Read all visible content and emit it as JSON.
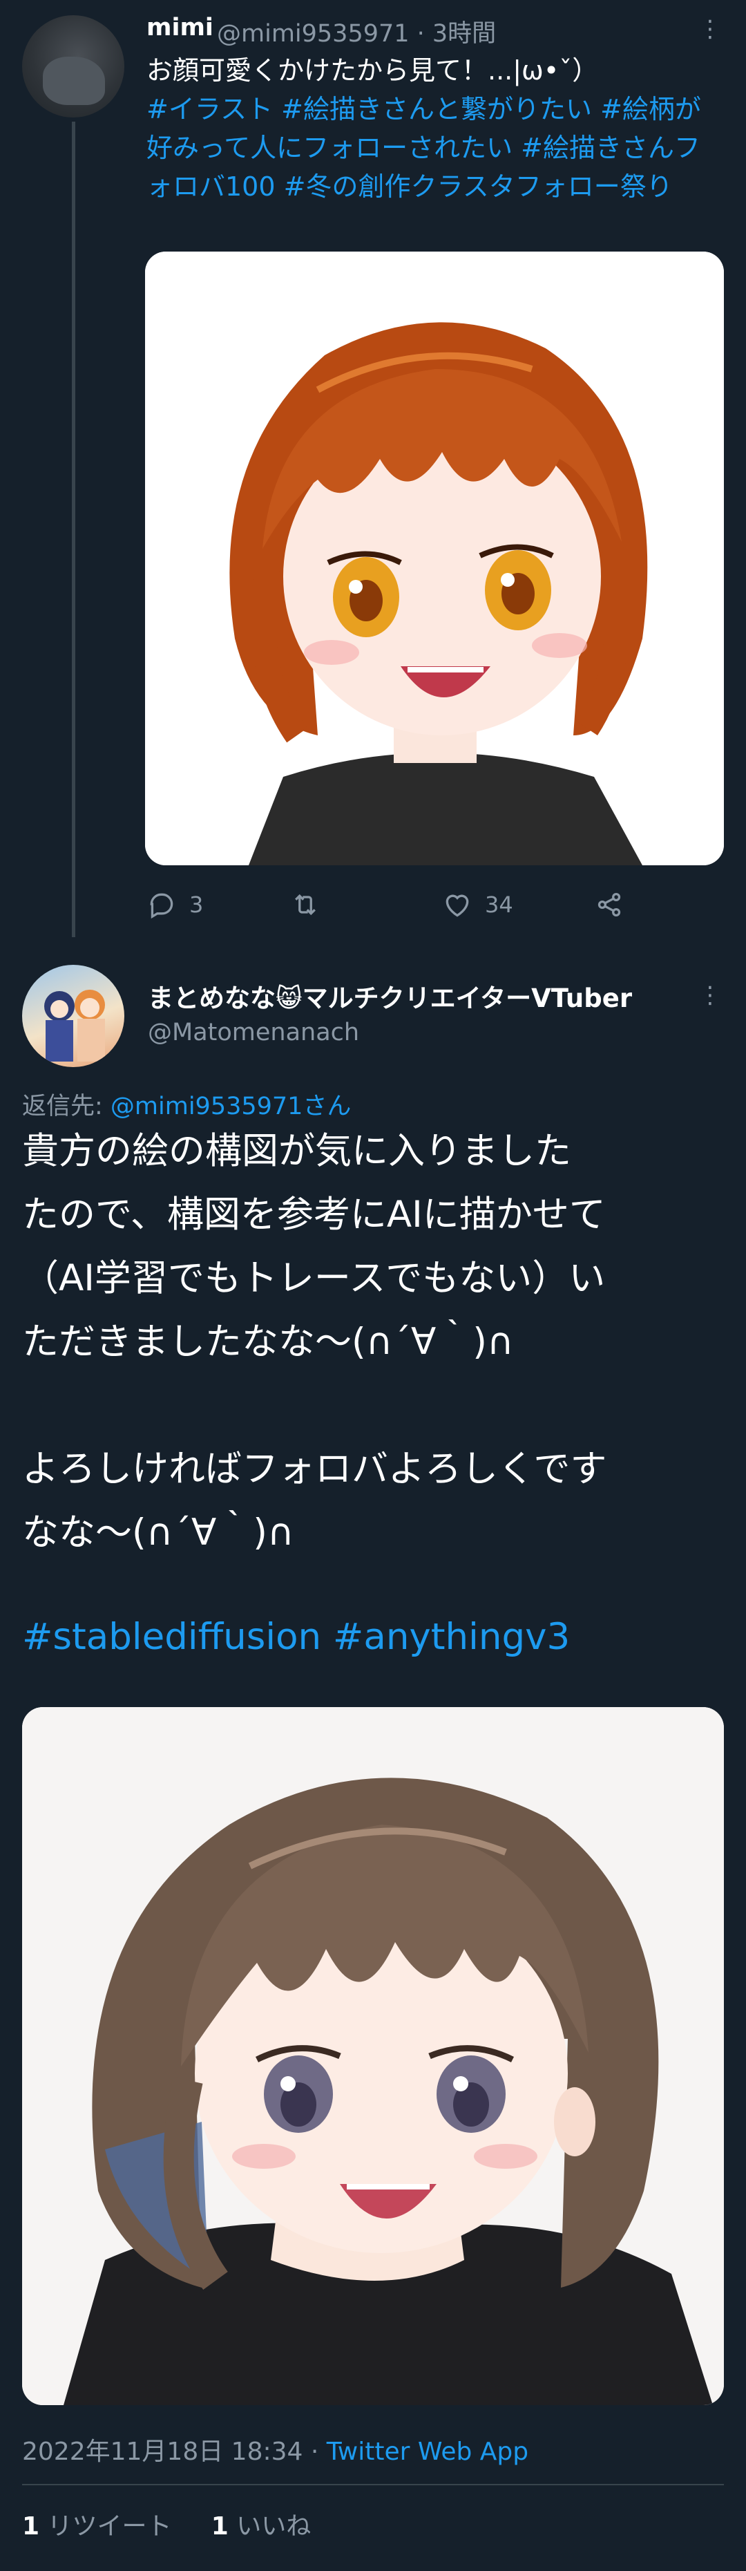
{
  "tweet1": {
    "author_name": "mimi",
    "author_handle": "@mimi9535971 · 3時間",
    "text": "お顔可愛くかけたから見て！...|ω•ˇ）",
    "hashtags": " #イラスト  #絵描きさんと繋がりたい  #絵柄が好みって人にフォローされたい  #絵描きさんフォロバ100   #冬の創作クラスタフォロー祭り",
    "image_icon": "anime-girl-illustration-orange-hair",
    "actions": {
      "reply_count": "3",
      "retweet_count": "",
      "like_count": "34"
    }
  },
  "tweet2": {
    "author_name": "まとめなな😸マルチクリエイターVTuber",
    "author_handle": "@Matomenanach",
    "reply_label": "返信先: ",
    "reply_target": "@mimi9535971さん",
    "body": "貴方の絵の構図が気に入りました\nたので、構図を参考にAIに描かせて\n（AI学習でもトレースでもない）い\nただきましたなな〜(∩´∀｀)∩\n\nよろしければフォロバよろしくです\nなな〜(∩´∀｀)∩",
    "hashtags": "#stablediffusion #anythingv3",
    "image_icon": "anime-girl-illustration-brown-hair",
    "timestamp": "2022年11月18日 18:34 · ",
    "client": "Twitter Web App",
    "retweets_num": "1",
    "retweets_label": " リツイート",
    "likes_num": "1",
    "likes_label": " いいね"
  },
  "colors": {
    "background": "#15202b",
    "secondary_text": "#8b98a5",
    "link": "#1d9bf0",
    "divider": "#38444d"
  }
}
